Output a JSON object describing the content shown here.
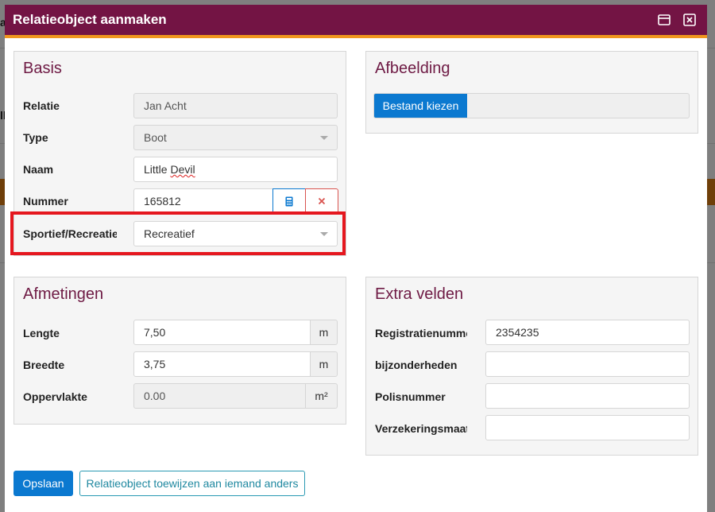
{
  "background": {
    "left_text_1": "a",
    "left_text_2": "ll"
  },
  "modal": {
    "title": "Relatieobject aanmaken",
    "header_icons": [
      "maximize-icon",
      "close-icon"
    ]
  },
  "basis": {
    "title": "Basis",
    "relatie": {
      "label": "Relatie",
      "value": "Jan Acht"
    },
    "type": {
      "label": "Type",
      "value": "Boot"
    },
    "naam": {
      "label": "Naam",
      "value_pre": "Little ",
      "value_err": "Devil"
    },
    "nummer": {
      "label": "Nummer",
      "value": "165812",
      "calc_icon": "calculator-icon",
      "clear_icon": "close-icon"
    },
    "sportief": {
      "label": "Sportief/Recreatief",
      "value": "Recreatief"
    }
  },
  "afbeelding": {
    "title": "Afbeelding",
    "file_button": "Bestand kiezen"
  },
  "afmetingen": {
    "title": "Afmetingen",
    "lengte": {
      "label": "Lengte",
      "value": "7,50",
      "unit": "m"
    },
    "breedte": {
      "label": "Breedte",
      "value": "3,75",
      "unit": "m"
    },
    "oppervlakte": {
      "label": "Oppervlakte",
      "value": "0.00",
      "unit": "m²"
    }
  },
  "extra": {
    "title": "Extra velden",
    "registratie": {
      "label": "Registratienummer",
      "value": "2354235"
    },
    "bijzonderheden": {
      "label": "bijzonderheden",
      "value": ""
    },
    "polis": {
      "label": "Polisnummer",
      "value": ""
    },
    "verzekering": {
      "label": "Verzekeringsmaatschappij",
      "value": ""
    }
  },
  "footer": {
    "save_label": "Opslaan",
    "assign_label": "Relatieobject toewijzen aan iemand anders"
  },
  "colors": {
    "header": "#731444",
    "header_border": "#f0961e",
    "primary": "#0b79d0",
    "highlight": "#e5171f",
    "section_title": "#6e1a44"
  }
}
